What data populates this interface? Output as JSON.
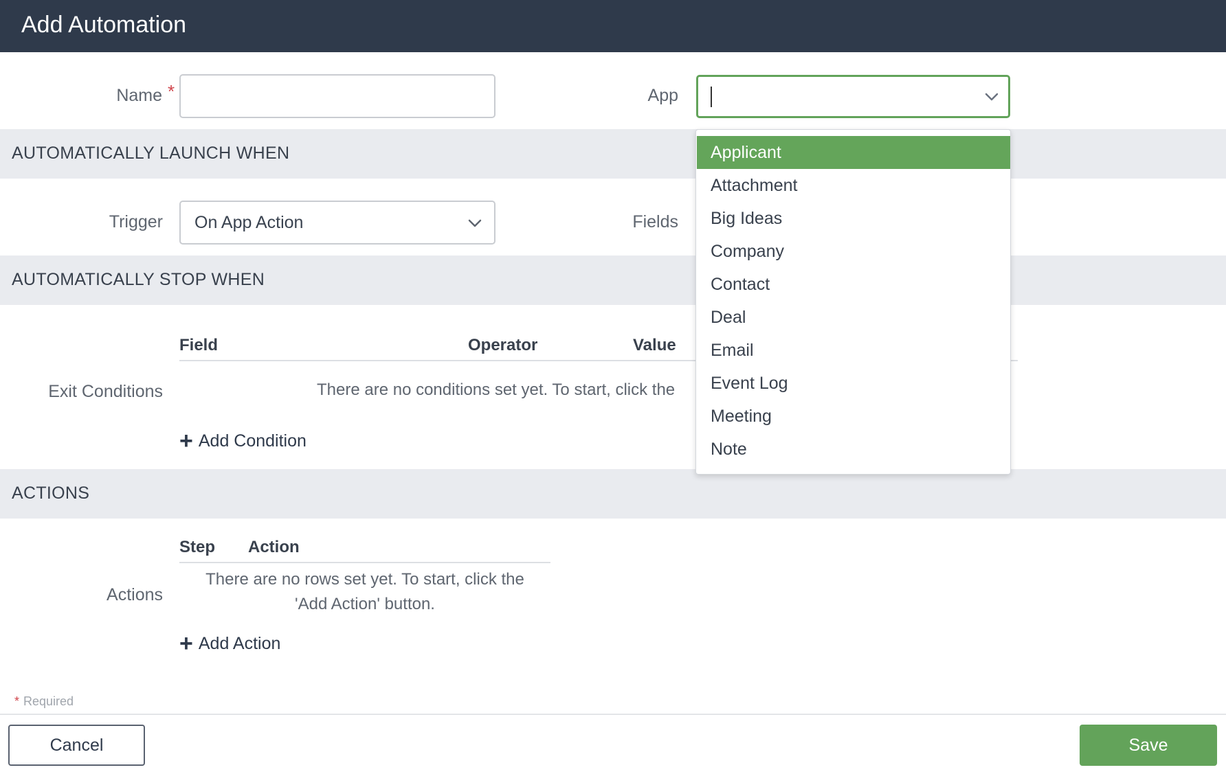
{
  "header": {
    "title": "Add Automation"
  },
  "form": {
    "name_label": "Name",
    "required_marker": "*",
    "name_value": "",
    "app_label": "App",
    "app_value": ""
  },
  "app_dropdown": {
    "options": [
      "Applicant",
      "Attachment",
      "Big Ideas",
      "Company",
      "Contact",
      "Deal",
      "Email",
      "Event Log",
      "Meeting",
      "Note"
    ],
    "highlighted": "Applicant"
  },
  "sections": {
    "launch": "AUTOMATICALLY LAUNCH WHEN",
    "stop": "AUTOMATICALLY STOP WHEN",
    "actions": "ACTIONS"
  },
  "launch": {
    "trigger_label": "Trigger",
    "trigger_value": "On App Action",
    "fields_label": "Fields"
  },
  "exit_conditions": {
    "label": "Exit Conditions",
    "columns": [
      "Field",
      "Operator",
      "Value"
    ],
    "empty_text": "There are no conditions set yet. To start, click the",
    "add_label": "Add Condition"
  },
  "actions": {
    "label": "Actions",
    "columns": [
      "Step",
      "Action"
    ],
    "empty_text_line1": "There are no rows set yet. To start, click the",
    "empty_text_line2": "'Add Action' button.",
    "add_label": "Add Action"
  },
  "footer": {
    "required_note": "Required",
    "cancel_label": "Cancel",
    "save_label": "Save"
  },
  "colors": {
    "header_bg": "#2f3a4b",
    "accent_green": "#64a55a",
    "section_bg": "#e9ebef",
    "required_red": "#d0454c"
  }
}
